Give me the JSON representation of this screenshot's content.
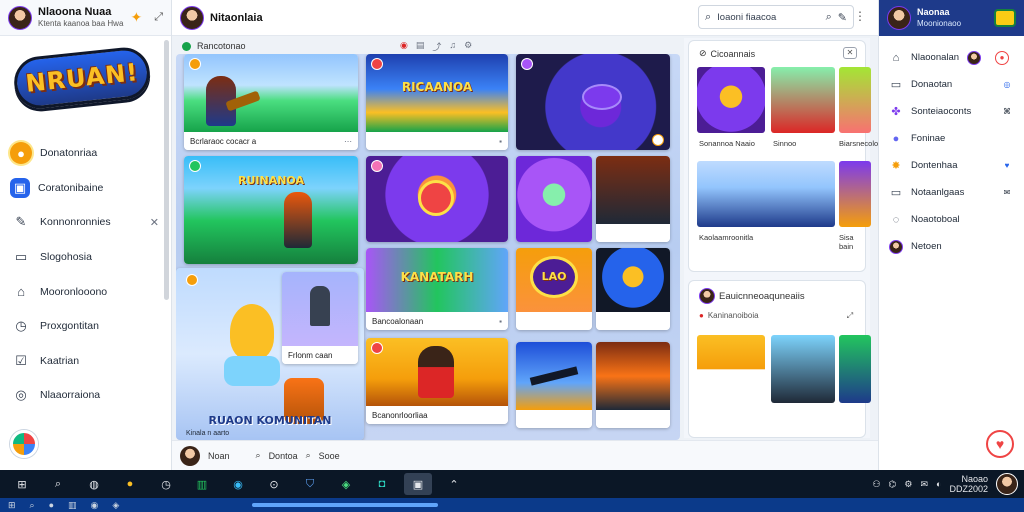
{
  "left_sidebar": {
    "profile_name": "Nlaoona Nuaa",
    "profile_sub": "Ktenta kaanoa baa Hwa",
    "logo_text": "NRUAN!",
    "nav": [
      {
        "label": "Donatonriaa",
        "icon": "fire-icon",
        "active": true
      },
      {
        "label": "Coratonibaine",
        "icon": "tv-icon",
        "active": false
      },
      {
        "label": "Konnonronnies",
        "icon": "chat-icon",
        "active": false,
        "trailing": "✕"
      },
      {
        "label": "Slogohosia",
        "icon": "page-icon",
        "active": false
      },
      {
        "label": "Mooronlooono",
        "icon": "folder-icon",
        "active": false
      },
      {
        "label": "Proxgontitan",
        "icon": "clock-icon",
        "active": false
      },
      {
        "label": "Kaatrian",
        "icon": "check-icon",
        "active": false
      },
      {
        "label": "Nlaaorraiona",
        "icon": "help-icon",
        "active": false
      }
    ]
  },
  "topbar": {
    "title": "Nitaonlaia",
    "search_placeholder": "Ioaoni fiaacoa"
  },
  "subbar": {
    "label": "Rancotonao"
  },
  "grid_cards": [
    {
      "caption": "Bcrlaraoc cocacr a"
    },
    {
      "caption": ""
    },
    {
      "caption": ""
    },
    {
      "caption": ""
    },
    {
      "caption": ""
    },
    {
      "caption": ""
    },
    {
      "caption": "Frlonm caan"
    },
    {
      "caption": "Bancoalonaan"
    },
    {
      "caption": ""
    },
    {
      "caption": ""
    },
    {
      "caption": ""
    },
    {
      "caption": ""
    },
    {
      "caption": "Bcanonrloorliaa"
    },
    {
      "caption": ""
    },
    {
      "caption": ""
    }
  ],
  "grid_texts": {
    "card2_title": "RICAANOA",
    "card6_title": "RUINANOA",
    "card8_title": "KANATARH",
    "card11_title": "LAO",
    "card13_title": "RUAON KOMUNITAN",
    "card13_sub": "Kinala n aarto"
  },
  "right_panel": {
    "top_head": "Cicoannais",
    "top_caps": [
      "Sonannoa Naaio",
      "Sinnoo",
      "Biarsnecolo"
    ],
    "top_caps2": [
      "Kaolaamroonitla",
      "Sisa bain"
    ],
    "mid_head": "Eauicnneoaquneaiis",
    "mid_sub": "Kaninanoiboia"
  },
  "right_sidebar": {
    "profile_name": "Naonaa",
    "profile_sub": "Moonionaoo",
    "items": [
      {
        "label": "Nlaoonalan",
        "icon": "home-icon",
        "tail": "●",
        "tail_color": "#ef4444"
      },
      {
        "label": "Donaotan",
        "icon": "page-icon",
        "tail": "◎",
        "tail_color": "#2563eb"
      },
      {
        "label": "Sonteiaoconts",
        "icon": "puzzle-icon",
        "tail": "⌘",
        "tail_color": "#374151"
      },
      {
        "label": "Foninae",
        "icon": "circle-icon",
        "tail": "",
        "tail_color": "#374151"
      },
      {
        "label": "Dontenhaa",
        "icon": "star-icon",
        "tail": "♥",
        "tail_color": "#2563eb"
      },
      {
        "label": "Notaanlgaas",
        "icon": "page-icon",
        "tail": "✉",
        "tail_color": "#374151"
      },
      {
        "label": "Noaotoboal",
        "icon": "chat-icon",
        "tail": "",
        "tail_color": "#374151"
      },
      {
        "label": "Netoen",
        "icon": "user-icon",
        "tail": "",
        "tail_color": "#374151"
      }
    ]
  },
  "bottom_strip": {
    "name": "Noan",
    "item1": "Dontoa",
    "item2": "Sooe"
  },
  "tray": {
    "time": "Naoao",
    "date": "DDZ2002"
  }
}
